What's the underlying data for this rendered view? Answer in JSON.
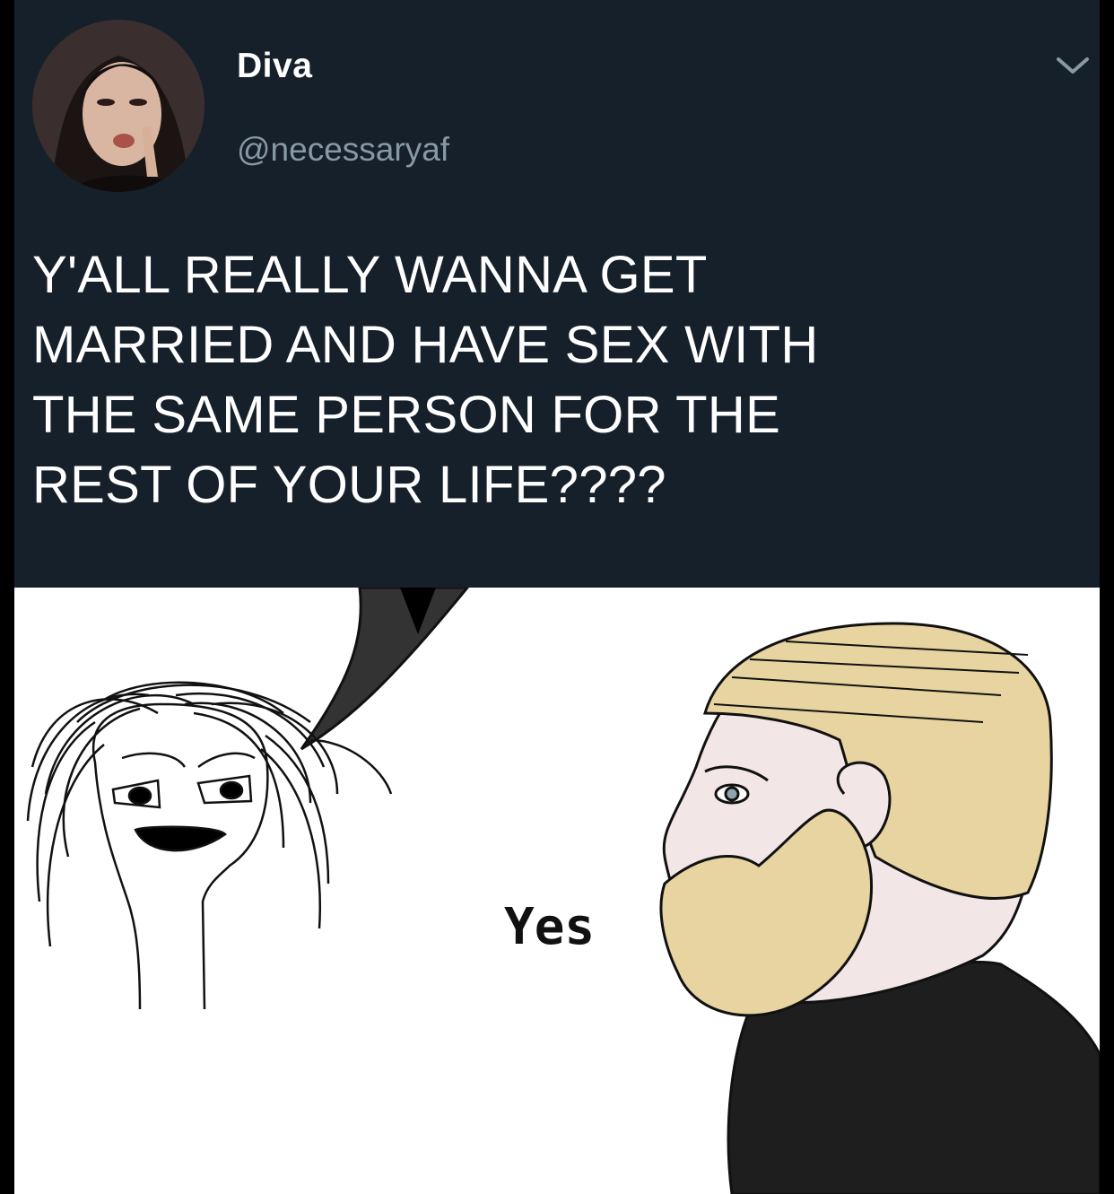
{
  "tweet": {
    "display_name": "Diva",
    "handle": "@necessaryaf",
    "text_lines": [
      "Y'ALL REALLY WANNA GET",
      "MARRIED AND HAVE SEX WITH",
      "THE SAME PERSON FOR THE",
      "REST OF YOUR LIFE????"
    ],
    "menu_icon": "chevron-down-icon",
    "avatar_icon": "profile-photo"
  },
  "meme": {
    "reply_text": "Yes",
    "left_figure": "wojak-screaming",
    "right_figure": "chad-yes"
  },
  "colors": {
    "tweet_bg": "#16202b",
    "name": "#ffffff",
    "handle": "#8899a6",
    "hair": "#e8d4a0",
    "skin": "#f3e6e6",
    "shirt": "#1e1e1e"
  }
}
